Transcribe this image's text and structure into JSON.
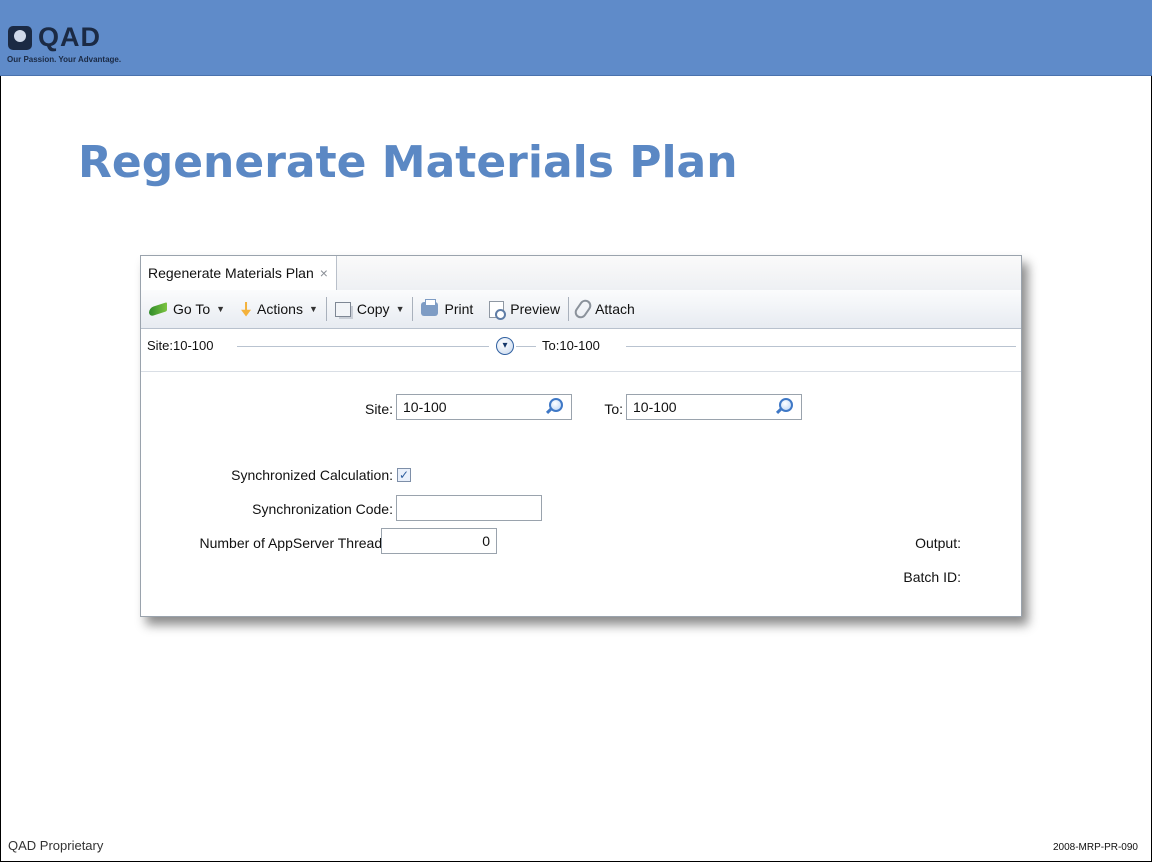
{
  "header": {
    "logo_text": "QAD",
    "tagline": "Our Passion. Your Advantage."
  },
  "slide_title": "Regenerate Materials Plan",
  "window": {
    "tab_label": "Regenerate Materials Plan",
    "tab_close_glyph": "×",
    "toolbar": {
      "goto_label": "Go To",
      "actions_label": "Actions",
      "copy_label": "Copy",
      "print_label": "Print",
      "preview_label": "Preview",
      "attach_label": "Attach"
    },
    "site_strip": {
      "from_text": "Site:10-100",
      "to_text": "To:10-100"
    },
    "form": {
      "site_label": "Site:",
      "site_value": "10-100",
      "to_label": "To:",
      "to_value": "10-100",
      "sync_calc_label": "Synchronized Calculation:",
      "sync_calc_checked": true,
      "sync_code_label": "Synchronization Code:",
      "sync_code_value": "",
      "threads_label": "Number of AppServer Threads:",
      "threads_value": "0",
      "output_label": "Output:",
      "batch_id_label": "Batch ID:"
    }
  },
  "footer": {
    "left": "QAD Proprietary",
    "right": "2008-MRP-PR-090"
  },
  "colors": {
    "header_band": "#5f8bc9",
    "title": "#5b88c4",
    "logo": "#1b2a44"
  }
}
